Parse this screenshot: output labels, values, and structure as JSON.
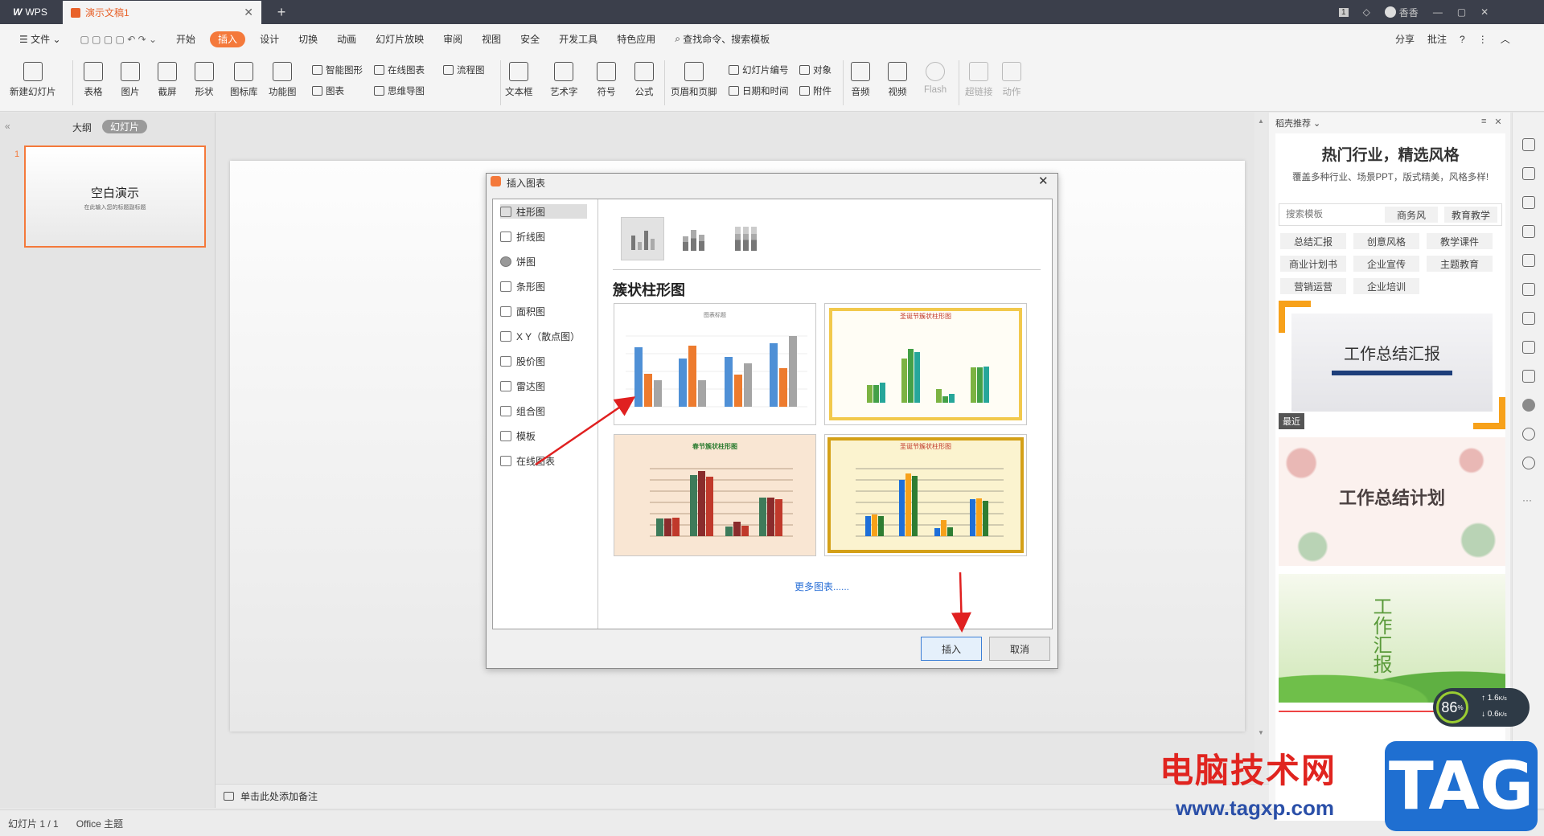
{
  "titlebar": {
    "app": "WPS",
    "doc_tab": "演示文稿1",
    "right_label": "香香"
  },
  "menu": [
    "文件",
    "开始",
    "插入",
    "设计",
    "切换",
    "动画",
    "幻灯片放映",
    "审阅",
    "视图",
    "安全",
    "开发工具",
    "特色应用",
    "查找命令、搜索模板"
  ],
  "menu_active": "插入",
  "menu_right": [
    "分享",
    "批注",
    "?"
  ],
  "ribbon": {
    "new_slide": "新建幻灯片",
    "table": "表格",
    "picture": "图片",
    "screenshot": "截屏",
    "shape": "形状",
    "iconlib": "图标库",
    "funcchart": "功能图",
    "smart_shape": "智能图形",
    "online_chart": "在线图表",
    "flowchart": "流程图",
    "chart": "图表",
    "mindmap": "思维导图",
    "textbox": "文本框",
    "wordart": "艺术字",
    "symbol": "符号",
    "formula": "公式",
    "header_footer": "页眉和页脚",
    "slide_num": "幻灯片编号",
    "object": "对象",
    "datetime": "日期和时间",
    "attachment": "附件",
    "audio": "音频",
    "video": "视频",
    "flash": "Flash",
    "hyperlink": "超链接",
    "action": "动作"
  },
  "left_panel": {
    "tab_outline": "大纲",
    "tab_slides": "幻灯片",
    "slide_no": "1",
    "thumb_title": "空白演示",
    "thumb_sub": "在此输入您的标题副标题"
  },
  "notes_placeholder": "单击此处添加备注",
  "status": {
    "slide": "幻灯片 1 / 1",
    "theme": "Office 主题"
  },
  "dialog": {
    "title": "插入图表",
    "chart_types": [
      "柱形图",
      "折线图",
      "饼图",
      "条形图",
      "面积图",
      "X Y（散点图）",
      "股价图",
      "雷达图",
      "组合图",
      "模板",
      "在线图表"
    ],
    "section_title": "簇状柱形图",
    "tpl1_title": "图表标题",
    "tpl2_title": "圣诞节簇状柱形图",
    "tpl3_title": "春节簇状柱形图",
    "tpl4_title": "圣诞节簇状柱形图",
    "more": "更多图表......",
    "insert": "插入",
    "cancel": "取消"
  },
  "right_panel": {
    "header": "稻壳推荐",
    "headline": "热门行业，精选风格",
    "subline": "覆盖多种行业、场景PPT，版式精美，风格多样!",
    "search_placeholder": "搜索模板",
    "tags": [
      "商务风",
      "教育教学",
      "总结汇报",
      "创意风格",
      "教学课件",
      "商业计划书",
      "企业宣传",
      "主题教育",
      "营销运营",
      "企业培训"
    ],
    "card1": "工作总结汇报",
    "card1_badge": "最近",
    "card2": "工作总结计划",
    "card3": "工作汇报"
  },
  "speed_widget": {
    "percent": "86",
    "up": "1.6",
    "down": "0.6",
    "unit": "K/s"
  },
  "watermark": {
    "text": "电脑技术网",
    "url": "www.tagxp.com",
    "logo": "TAG"
  },
  "colors": {
    "accent": "#f4793b",
    "blue": "#4f90d6",
    "orange": "#ed7b2e",
    "gray": "#a5a5a5",
    "arrow": "#e02020"
  }
}
